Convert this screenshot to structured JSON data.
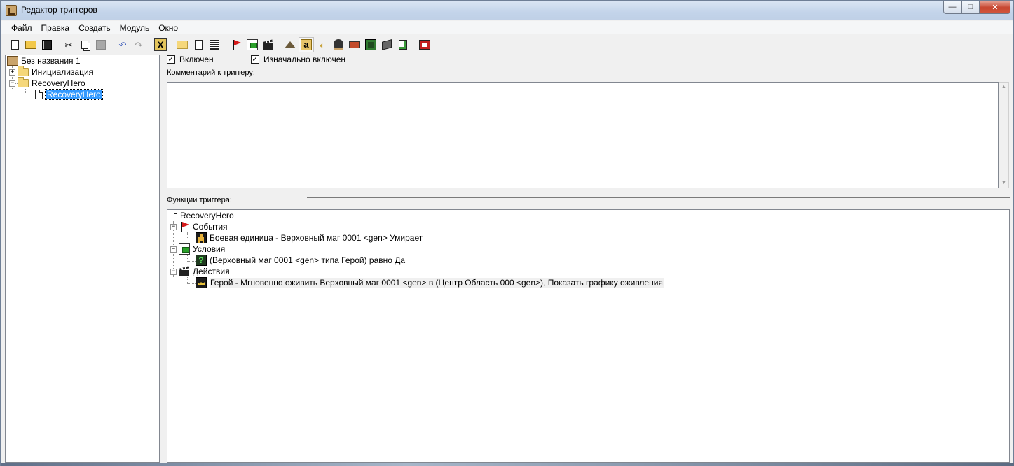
{
  "window": {
    "title": "Редактор триггеров",
    "controls": {
      "minimize": "—",
      "maximize": "□",
      "close": "✕"
    }
  },
  "menu": [
    "Файл",
    "Правка",
    "Создать",
    "Модуль",
    "Окно"
  ],
  "toolbar": {
    "icons": [
      "new-document-icon",
      "open-folder-icon",
      "save-icon",
      "cut-icon",
      "copy-icon",
      "paste-icon",
      "undo-icon",
      "redo-icon",
      "delete-x-icon",
      "new-category-icon",
      "new-trigger-icon",
      "new-comment-icon",
      "new-event-icon",
      "new-condition-icon",
      "new-action-icon",
      "terrain-icon",
      "text-icon",
      "sound-icon",
      "unit-icon",
      "import-icon",
      "minimap-icon",
      "object-icon",
      "script-icon",
      "test-map-icon"
    ]
  },
  "tree": {
    "root": "Без названия 1",
    "items": [
      {
        "label": "Инициализация",
        "expander": "+"
      },
      {
        "label": "RecoveryHero",
        "expander": "−"
      }
    ],
    "selected": "RecoveryHero"
  },
  "trigger": {
    "enabled_label": "Включен",
    "enabled": true,
    "initially_on_label": "Изначально включен",
    "initially_on": true,
    "comment_label": "Комментарий к триггеру:",
    "comment_value": "",
    "functions_label": "Функции триггера:"
  },
  "functions": {
    "trigger_name": "RecoveryHero",
    "events_label": "События",
    "event_text": "Боевая единица - Верховный маг 0001 <gen> Умирает",
    "conditions_label": "Условия",
    "condition_text": "(Верховный маг 0001 <gen> типа Герой) равно Да",
    "actions_label": "Действия",
    "action_text": "Герой - Мгновенно оживить Верховный маг 0001 <gen> в (Центр Область 000 <gen>), Показать графику оживления"
  }
}
